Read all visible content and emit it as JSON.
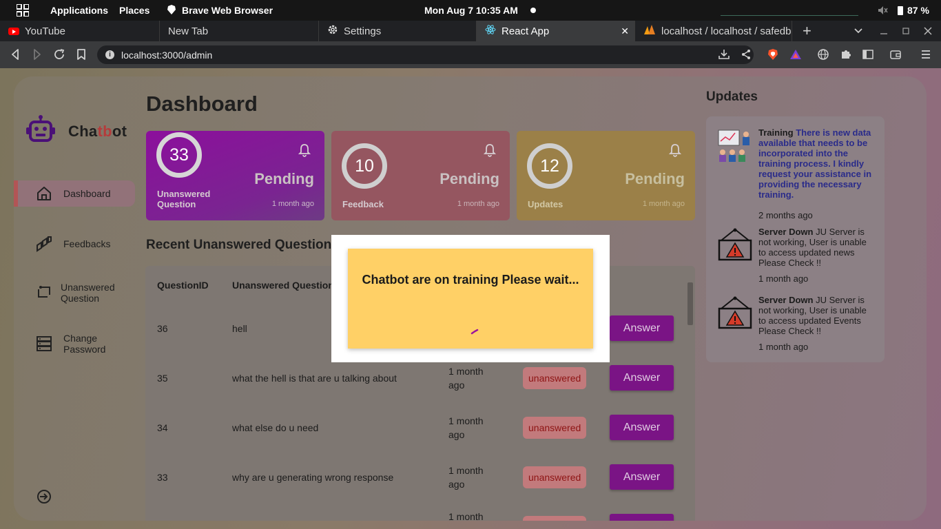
{
  "system": {
    "applications": "Applications",
    "places": "Places",
    "active_app": "Brave Web Browser",
    "clock": "Mon Aug 7  10:35 AM",
    "battery": "87 %"
  },
  "browser": {
    "tabs": [
      {
        "title": "YouTube"
      },
      {
        "title": "New Tab"
      },
      {
        "title": "Settings"
      },
      {
        "title": "React App"
      },
      {
        "title": "localhost / localhost / safedb"
      }
    ],
    "url": "localhost:3000/admin"
  },
  "app": {
    "logo": {
      "part1": "Cha",
      "part2": "tb",
      "part3": "ot"
    },
    "sidebar": {
      "items": [
        {
          "label": "Dashboard"
        },
        {
          "label": "Feedbacks"
        },
        {
          "label": "Unanswered Question"
        },
        {
          "label": "Change Password"
        }
      ]
    },
    "title": "Dashboard",
    "cards": [
      {
        "count": "33",
        "status": "Pending",
        "label": "Unanswered Question",
        "ago": "1 month ago"
      },
      {
        "count": "10",
        "status": "Pending",
        "label": "Feedback",
        "ago": "1 month ago"
      },
      {
        "count": "12",
        "status": "Pending",
        "label": "Updates",
        "ago": "1 month ago"
      }
    ],
    "recent_title": "Recent Unanswered Question",
    "table": {
      "headers": {
        "id": "QuestionID",
        "question": "Unanswered Question"
      },
      "rows": [
        {
          "id": "36",
          "question": "hell",
          "date": "",
          "status": "",
          "action": "Answer"
        },
        {
          "id": "35",
          "question": "what the hell is that are u talking about",
          "date": "1 month ago",
          "status": "unanswered",
          "action": "Answer"
        },
        {
          "id": "34",
          "question": "what else do u need",
          "date": "1 month ago",
          "status": "unanswered",
          "action": "Answer"
        },
        {
          "id": "33",
          "question": "why are u generating wrong response",
          "date": "1 month ago",
          "status": "unanswered",
          "action": "Answer"
        },
        {
          "id": "",
          "question": "",
          "date": "1 month",
          "status": "",
          "action": ""
        }
      ]
    },
    "updates": {
      "title": "Updates",
      "items": [
        {
          "heading": "Training",
          "body": "There is new data available that needs to be incorporated into the training process. I kindly request your assistance in providing the necessary training.",
          "ago": "2 months ago"
        },
        {
          "heading": "Server Down",
          "body": "JU Server is not working, User is unable to access updated news Please Check !!",
          "ago": "1 month ago"
        },
        {
          "heading": "Server Down",
          "body": "JU Server is not working, User is unable to access updated Events Please Check !!",
          "ago": "1 month ago"
        }
      ]
    },
    "modal": {
      "message": "Chatbot are on training Please wait..."
    }
  },
  "colors": {
    "accent_purple": "#7a1485",
    "modal_yellow": "#ffd066",
    "badge_red": "#8e1414"
  }
}
